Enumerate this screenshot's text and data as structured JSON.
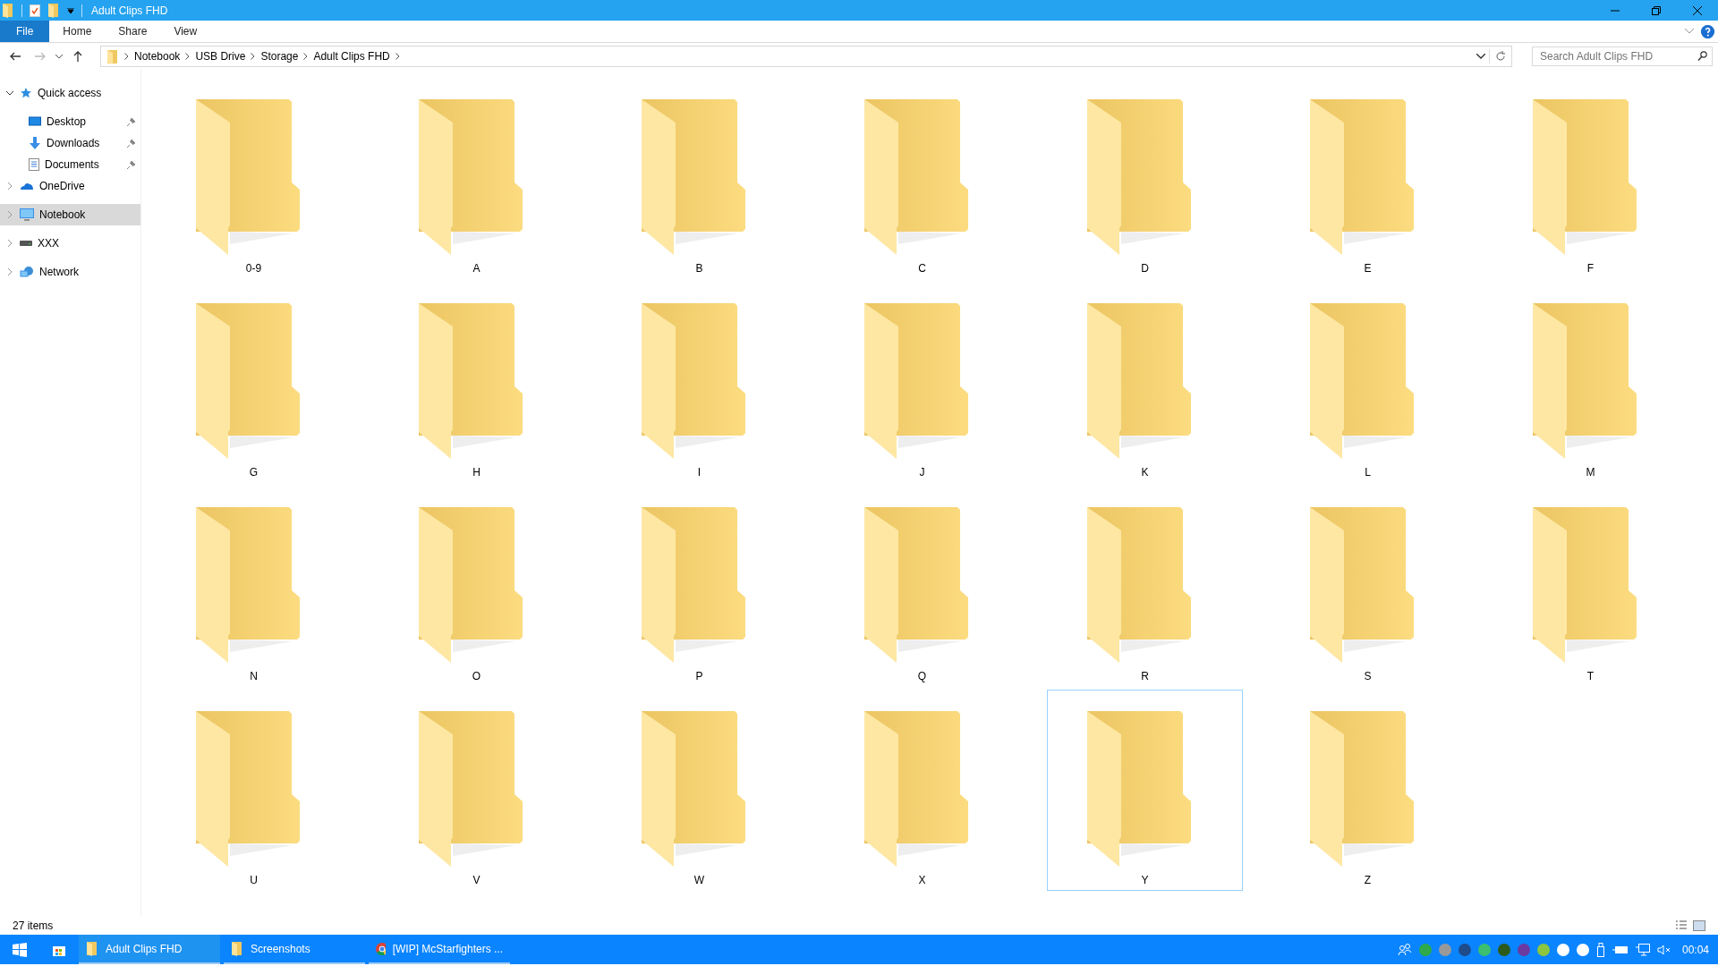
{
  "window": {
    "title": "Adult Clips FHD"
  },
  "ribbon_tabs": [
    {
      "label": "File",
      "selected": true
    },
    {
      "label": "Home",
      "selected": false
    },
    {
      "label": "Share",
      "selected": false
    },
    {
      "label": "View",
      "selected": false
    }
  ],
  "breadcrumb": [
    "Notebook",
    "USB Drive",
    "Storage",
    "Adult Clips FHD"
  ],
  "search": {
    "placeholder": "Search Adult Clips FHD"
  },
  "sidebar": {
    "items": [
      {
        "label": "Quick access",
        "kind": "star",
        "expanded": true,
        "selected": false,
        "children": [
          {
            "label": "Desktop",
            "kind": "desktop",
            "pinned": true
          },
          {
            "label": "Downloads",
            "kind": "download",
            "pinned": true
          },
          {
            "label": "Documents",
            "kind": "document",
            "pinned": true
          }
        ]
      },
      {
        "label": "OneDrive",
        "kind": "cloud",
        "expanded": false,
        "selected": false
      },
      {
        "label": "Notebook",
        "kind": "computer",
        "expanded": false,
        "selected": true
      },
      {
        "label": "XXX",
        "kind": "drive",
        "expanded": false,
        "selected": false
      },
      {
        "label": "Network",
        "kind": "network",
        "expanded": false,
        "selected": false
      }
    ]
  },
  "folders": [
    {
      "name": "0-9",
      "selected": false
    },
    {
      "name": "A",
      "selected": false
    },
    {
      "name": "B",
      "selected": false
    },
    {
      "name": "C",
      "selected": false
    },
    {
      "name": "D",
      "selected": false
    },
    {
      "name": "E",
      "selected": false
    },
    {
      "name": "F",
      "selected": false
    },
    {
      "name": "G",
      "selected": false
    },
    {
      "name": "H",
      "selected": false
    },
    {
      "name": "I",
      "selected": false
    },
    {
      "name": "J",
      "selected": false
    },
    {
      "name": "K",
      "selected": false
    },
    {
      "name": "L",
      "selected": false
    },
    {
      "name": "M",
      "selected": false
    },
    {
      "name": "N",
      "selected": false
    },
    {
      "name": "O",
      "selected": false
    },
    {
      "name": "P",
      "selected": false
    },
    {
      "name": "Q",
      "selected": false
    },
    {
      "name": "R",
      "selected": false
    },
    {
      "name": "S",
      "selected": false
    },
    {
      "name": "T",
      "selected": false
    },
    {
      "name": "U",
      "selected": false
    },
    {
      "name": "V",
      "selected": false
    },
    {
      "name": "W",
      "selected": false
    },
    {
      "name": "X",
      "selected": false
    },
    {
      "name": "Y",
      "selected": true
    },
    {
      "name": "Z",
      "selected": false
    }
  ],
  "status_bar": {
    "item_count": "27 items"
  },
  "taskbar": {
    "items": [
      {
        "label": "Adult Clips FHD",
        "kind": "folder",
        "selected": true
      },
      {
        "label": "Screenshots",
        "kind": "folder",
        "selected": false
      },
      {
        "label": "[WIP] McStarfighters ...",
        "kind": "browser",
        "selected": false
      }
    ],
    "clock": "00:04"
  }
}
